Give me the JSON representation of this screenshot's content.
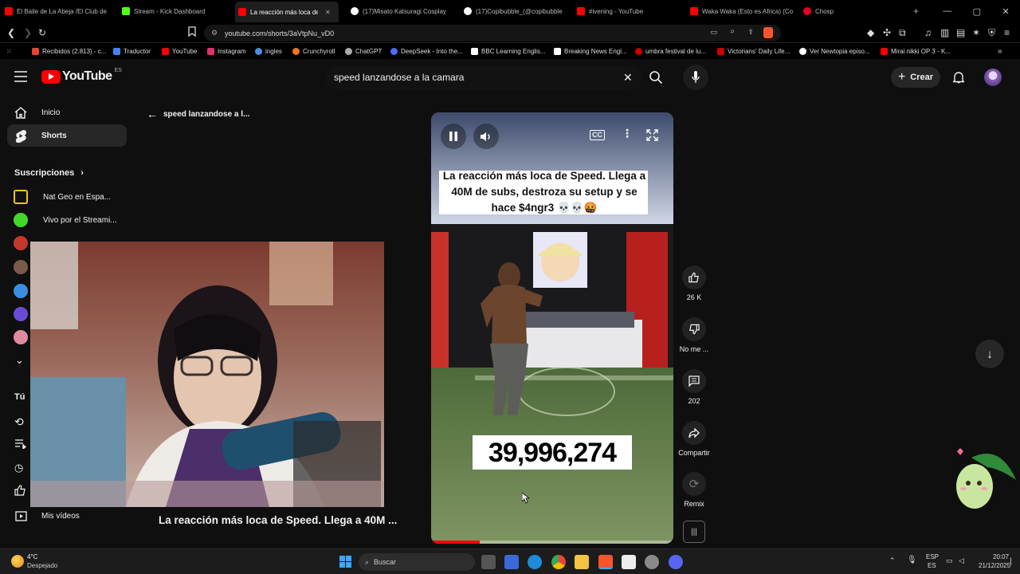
{
  "browser": {
    "tabs": [
      {
        "title": "El Baile de La Abeja /El Club de",
        "color": "#ff0000"
      },
      {
        "title": "Stream - Kick Dashboard",
        "color": "#53fc18"
      },
      {
        "title": "La reacción más loca de",
        "color": "#ff0000"
      },
      {
        "title": "(17)Misato Katsuragi Cosplay",
        "color": "#ffffff"
      },
      {
        "title": "(17)Copibubble_(@copibubble",
        "color": "#ffffff"
      },
      {
        "title": "#ivening - YouTube",
        "color": "#ff0000"
      },
      {
        "title": "Waka Waka (Esto es Africa) (Co",
        "color": "#ff0000"
      },
      {
        "title": "Chosp",
        "color": "#e60023"
      }
    ],
    "url": "youtube.com/shorts/3aVtpNu_vD0",
    "bookmarks": [
      {
        "label": "Recibidos (2.813) - c...",
        "color": "#ea4335"
      },
      {
        "label": "Traductor",
        "color": "#4285f4"
      },
      {
        "label": "YouTube",
        "color": "#ff0000"
      },
      {
        "label": "Instagram",
        "color": "#e1306c"
      },
      {
        "label": "ingles",
        "color": "#4a90e2"
      },
      {
        "label": "Crunchyroll",
        "color": "#f47521"
      },
      {
        "label": "ChatGPT",
        "color": "#aaaaaa"
      },
      {
        "label": "DeepSeek - Into the...",
        "color": "#4d6bfe"
      },
      {
        "label": "BBC Learning Englis...",
        "color": "#ffffff"
      },
      {
        "label": "Breaking News Engl...",
        "color": "#ffffff"
      },
      {
        "label": "umbra festival de lu...",
        "color": "#cc0000"
      },
      {
        "label": "Victorians' Daily Life...",
        "color": "#cc0000"
      },
      {
        "label": "Ver Newtopia episo...",
        "color": "#ffffff"
      },
      {
        "label": "Mirai nikki OP 3 - K...",
        "color": "#ff0000"
      }
    ]
  },
  "youtube": {
    "logo_text": "YouTube",
    "logo_region": "ES",
    "search_value": "speed lanzandose a la camara",
    "create_label": "Crear",
    "back_label": "speed lanzandose a l...",
    "sidebar": {
      "home": "Inicio",
      "shorts": "Shorts",
      "subs_heading": "Suscripciones",
      "channels": [
        {
          "name": "Nat Geo en Espa...",
          "color": "#f5c518"
        },
        {
          "name": "Vivo por el Streami...",
          "color": "#45d62e"
        }
      ],
      "you_heading": "Tú",
      "my_videos": "Mis vídeos"
    },
    "short": {
      "caption": "La reacción más loca de Speed. Llega a 40M de subs, destroza su setup y se hace $4ngr3 💀💀🤬",
      "counter": "39,996,274",
      "bottom_title": "La reacción más loca de Speed. Llega a 40M ...",
      "progress": 0.2
    },
    "actions": {
      "likes": "26 K",
      "dislike": "No me ...",
      "comments": "202",
      "share": "Compartir",
      "remix": "Remix"
    }
  },
  "taskbar": {
    "temp": "4°C",
    "weather": "Despejado",
    "search_placeholder": "Buscar",
    "lang_line1": "ESP",
    "lang_line2": "ES",
    "time": "20:07",
    "date": "21/12/2025"
  },
  "colors": {
    "yt_red": "#ff0000",
    "page_bg": "#0f0f0f",
    "chip": "#272727"
  }
}
